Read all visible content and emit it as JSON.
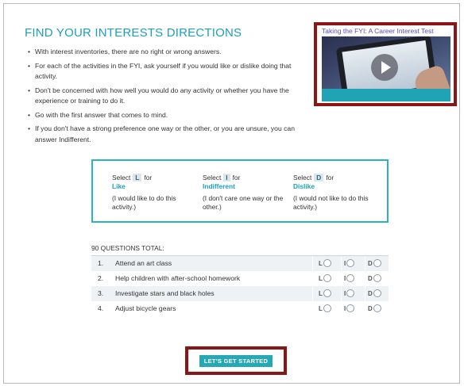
{
  "page": {
    "title": "FIND YOUR INTERESTS DIRECTIONS",
    "bullets": [
      "With interest inventories, there are no right or wrong answers.",
      "For each of the activities in the FYI, ask yourself if you would like or dislike doing that activity.",
      "Don't be concerned with how well you would do any activity or whether you have the experience or training to do it.",
      "Go with the first answer that comes to mind.",
      "If you don't have a strong preference one way or the other, or you are unsure, you can answer Indifferent."
    ]
  },
  "video": {
    "title": "Taking the FYI: A Career Interest Test",
    "icon": "play-icon"
  },
  "legend": [
    {
      "select": "Select",
      "key": "L",
      "for": "for",
      "word": "Like",
      "desc": "(I would like to do this activity.)"
    },
    {
      "select": "Select",
      "key": "I",
      "for": "for",
      "word": "Indifferent",
      "desc": "(I don't care one way or the other.)"
    },
    {
      "select": "Select",
      "key": "D",
      "for": "for",
      "word": "Dislike",
      "desc": "(I would not like to do this activity.)"
    }
  ],
  "questions": {
    "total_label": "90 QUESTIONS TOTAL:",
    "items": [
      {
        "num": "1.",
        "text": "Attend an art class"
      },
      {
        "num": "2.",
        "text": "Help children with after-school homework"
      },
      {
        "num": "3.",
        "text": "Investigate stars and black holes"
      },
      {
        "num": "4.",
        "text": "Adjust bicycle gears"
      }
    ],
    "option_labels": [
      "L",
      "I",
      "D"
    ]
  },
  "cta": {
    "label": "LET'S GET STARTED"
  },
  "colors": {
    "accent": "#1f9fb6",
    "highlight_border": "#8a1616",
    "button": "#27a9b5"
  }
}
